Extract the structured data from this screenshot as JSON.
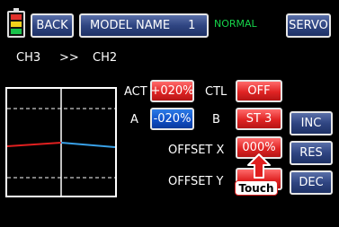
{
  "header": {
    "back_label": "BACK",
    "model_name_label": "MODEL NAME",
    "model_number": "1",
    "mode_status": "NORMAL",
    "servo_label": "SERVO"
  },
  "mix": {
    "from_channel": "CH3",
    "arrow": ">>",
    "to_channel": "CH2"
  },
  "params": {
    "act_label": "ACT",
    "act_value": "+020%",
    "ctl_label": "CTL",
    "ctl_value": "OFF",
    "a_label": "A",
    "a_value": "-020%",
    "b_label": "B",
    "b_value": "ST 3",
    "offset_x_label": "OFFSET X",
    "offset_x_value": "000%",
    "offset_y_label": "OFFSET Y"
  },
  "side_buttons": {
    "inc": "INC",
    "res": "RES",
    "dec": "DEC"
  },
  "annotation": {
    "touch_label": "Touch"
  },
  "colors": {
    "mode_status": "#16d34a",
    "curve_left": "#e02020",
    "curve_right": "#39a0e6",
    "highlight_red": "#e02424",
    "highlight_blue": "#1050c8"
  }
}
